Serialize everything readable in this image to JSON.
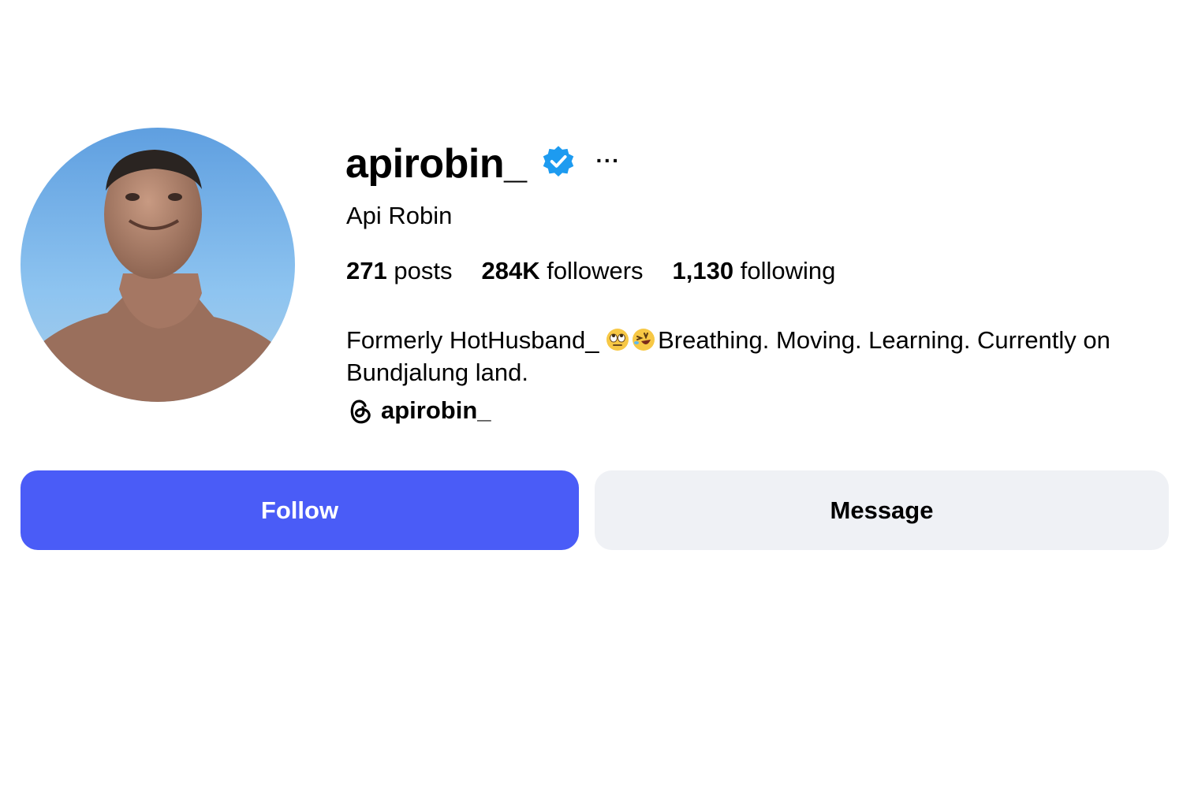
{
  "profile": {
    "username": "apirobin_",
    "full_name": "Api Robin",
    "verified_icon": "verified-badge-icon",
    "more_label": "···",
    "avatar_icon": "profile-photo"
  },
  "stats": [
    {
      "value": "271",
      "label": "posts"
    },
    {
      "value": "284K",
      "label": "followers"
    },
    {
      "value": "1,130",
      "label": "following"
    }
  ],
  "bio": {
    "text_before_emoji": "Formerly HotHusband_ ",
    "emojis": [
      "eye-roll-emoji",
      "rolling-laughing-emoji"
    ],
    "text_after_emoji": "Breathing. Moving. Learning. Currently on Bundjalung land."
  },
  "threads": {
    "icon": "threads-icon",
    "handle": "apirobin_"
  },
  "buttons": {
    "follow_label": "Follow",
    "message_label": "Message"
  },
  "colors": {
    "follow_bg": "#4a5cf7",
    "message_bg": "#eff1f5",
    "verified_blue": "#1d9bf0"
  }
}
